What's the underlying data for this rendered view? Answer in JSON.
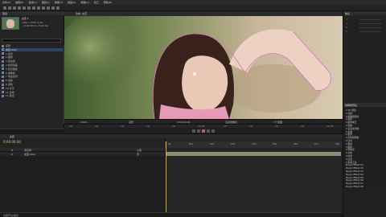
{
  "menu": [
    "文件(F)",
    "编辑(E)",
    "合成(C)",
    "图层(L)",
    "效果(T)",
    "动画(A)",
    "视图(V)",
    "窗口",
    "帮助(H)"
  ],
  "project": {
    "tab": "项目",
    "asset_name": "女孩 ▾",
    "asset_info1": "1920 x 1080 (1.00)",
    "asset_info2": "△ 0:00:08:14, 25.00 fps",
    "rows": [
      {
        "label": "名称",
        "sel": false
      },
      {
        "label": "女孩.mov",
        "sel": true
      },
      {
        "label": "1 遮罩",
        "sel": false
      },
      {
        "label": "2 图层",
        "sel": false
      },
      {
        "label": "3 固态层",
        "sel": false
      },
      {
        "label": "4 遮罩动画",
        "sel": false
      },
      {
        "label": "5 稳定跟踪",
        "sel": false
      },
      {
        "label": "6 摄像机",
        "sel": false
      },
      {
        "label": "7 动态遮罩",
        "sel": false
      },
      {
        "label": "8 追踪",
        "sel": false
      },
      {
        "label": "9 调色",
        "sel": false
      },
      {
        "label": "10 文字",
        "sel": false
      },
      {
        "label": "11 合成",
        "sel": false
      },
      {
        "label": "12 输出",
        "sel": false
      }
    ]
  },
  "viewer": {
    "tab": "合成: 女孩",
    "controls": [
      "100%",
      "完整",
      "0:00:00:00",
      "活动摄像机",
      "1个视图"
    ],
    "ruler_ticks": [
      "00f",
      "05f",
      "10f",
      "15f",
      "20f",
      "01:00f",
      "05f",
      "10f",
      "15f",
      "20f",
      "02:00f"
    ]
  },
  "info": {
    "tab": "信息",
    "meters": [
      "R",
      "G",
      "B",
      "A"
    ]
  },
  "effects": {
    "tab": "效果和预设",
    "items": [
      "▾ 3D 通道",
      "▾ 音频",
      "▾ 模糊和锐化",
      "▾ 通道",
      "▾ 颜色校正",
      "▾ 扭曲",
      "▾ 表达式控制",
      "▾ 生成",
      "▾ 遮罩",
      "▾ 杂色和颗粒",
      "▾ 过时",
      "▾ 透视",
      "▾ 模拟",
      "▾ 风格化",
      "▾ 文本",
      "▾ 时间",
      "▾ 过渡",
      "▾ 实用工具",
      "Plugin Effect 01",
      "Plugin Effect 02",
      "Plugin Effect 03",
      "Plugin Effect 04",
      "Plugin Effect 05",
      "Plugin Effect 06",
      "Plugin Effect 07",
      "Plugin Effect 08"
    ]
  },
  "timeline": {
    "tab": "女孩",
    "timecode": "0:00:00:00",
    "cols": [
      "#",
      "源名称",
      "父级"
    ],
    "layer": {
      "num": "1",
      "name": "女孩.mov",
      "parent": "无"
    },
    "ruler": [
      "0s",
      "01s",
      "02s",
      "03s",
      "04s",
      "05s",
      "06s",
      "07s",
      "08s"
    ]
  },
  "status": {
    "left": "切换开关/模式"
  },
  "colors": {
    "accent": "#2b4766",
    "playhead": "#e0b02f",
    "track": "#8a8f74",
    "mask": "#e070c8"
  }
}
